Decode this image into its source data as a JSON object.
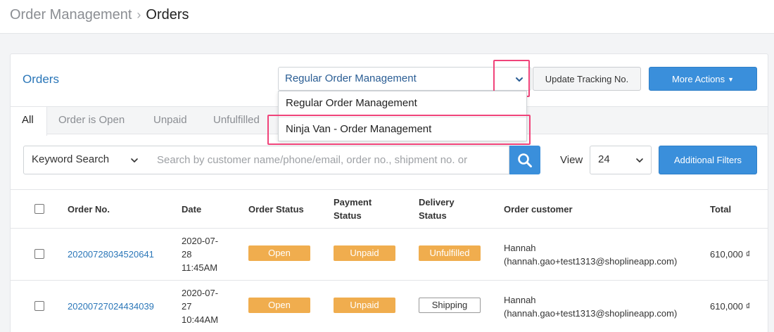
{
  "breadcrumb": {
    "parent": "Order Management",
    "separator": "›",
    "current": "Orders"
  },
  "header": {
    "title": "Orders",
    "mode_select": {
      "value": "Regular Order Management"
    },
    "update_tracking_label": "Update Tracking No.",
    "more_actions_label": "More Actions"
  },
  "mode_dropdown": {
    "options": [
      "Regular Order Management",
      "Ninja Van - Order Management"
    ]
  },
  "highlight_color": "#f0437a",
  "accent_color": "#3a8fdb",
  "tabs": [
    {
      "label": "All",
      "active": true
    },
    {
      "label": "Order is Open"
    },
    {
      "label": "Unpaid"
    },
    {
      "label": "Unfulfilled"
    }
  ],
  "search": {
    "type_value": "Keyword Search",
    "placeholder": "Search by customer name/phone/email, order no., shipment no. or",
    "button_icon": "search-icon"
  },
  "view": {
    "label": "View",
    "value": "24"
  },
  "additional_filters_label": "Additional Filters",
  "table": {
    "columns": {
      "order_no": "Order No.",
      "date": "Date",
      "order_status": "Order Status",
      "payment_status_1": "Payment",
      "payment_status_2": "Status",
      "delivery_status_1": "Delivery",
      "delivery_status_2": "Status",
      "customer": "Order customer",
      "total": "Total"
    },
    "rows": [
      {
        "order_no": "20200728034520641",
        "date_1": "2020-07-",
        "date_2": "28",
        "date_3": "11:45AM",
        "order_status": "Open",
        "payment_status": "Unpaid",
        "delivery_status": "Unfulfilled",
        "customer_name": "Hannah",
        "customer_email": "(hannah.gao+test1313@shoplineapp.com)",
        "total": "610,000 ₫"
      },
      {
        "order_no": "20200727024434039",
        "date_1": "2020-07-",
        "date_2": "27",
        "date_3": "10:44AM",
        "order_status": "Open",
        "payment_status": "Unpaid",
        "delivery_status": "Shipping",
        "customer_name": "Hannah",
        "customer_email": "(hannah.gao+test1313@shoplineapp.com)",
        "total": "610,000 ₫"
      }
    ]
  }
}
